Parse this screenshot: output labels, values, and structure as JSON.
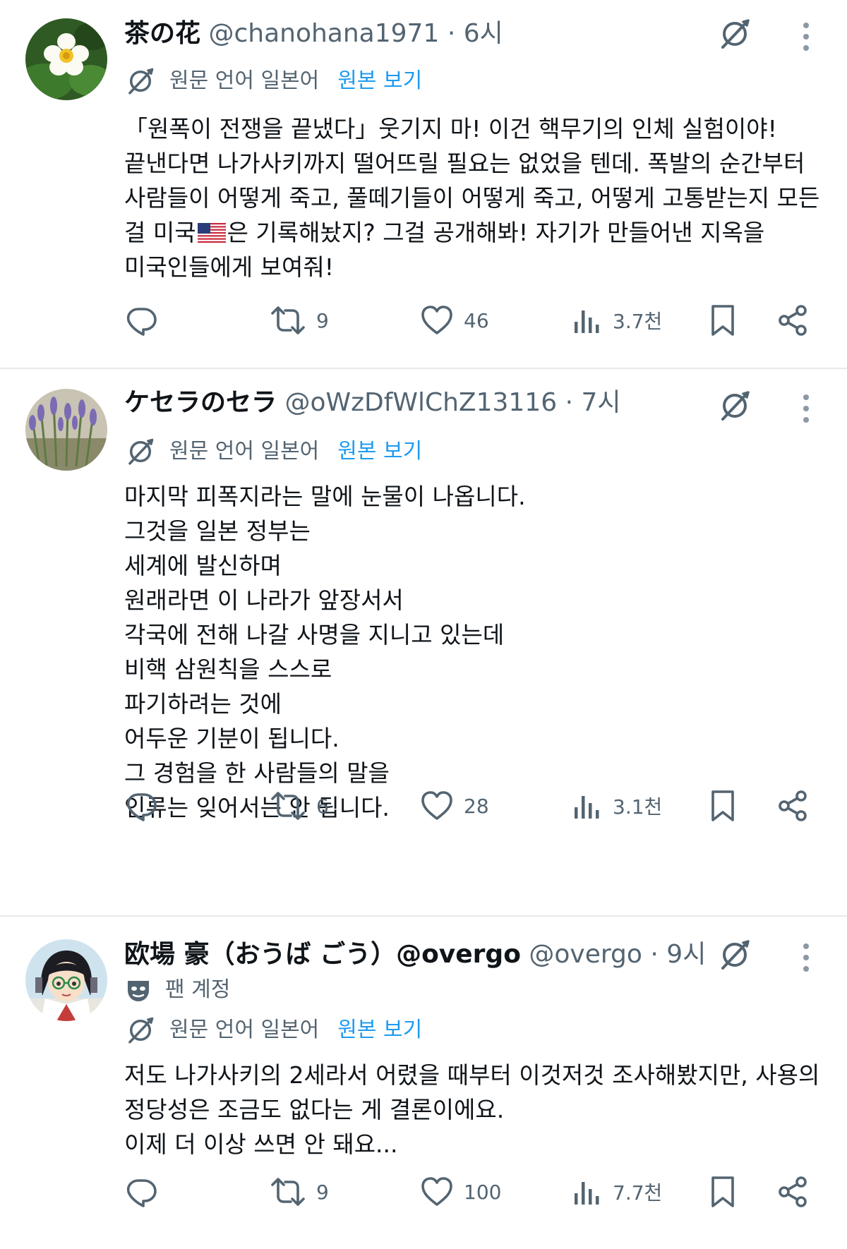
{
  "translate": {
    "lang_label": "원문 언어 일본어",
    "show_original": "원본 보기"
  },
  "tweets": [
    {
      "display_name": "茶の花",
      "handle": "@chanohana1971",
      "time": "6시",
      "text_before_flag": "「원폭이 전쟁을 끝냈다」웃기지 마! 이건 핵무기의 인체 실험이야!\n끝낸다면 나가사키까지 떨어뜨릴 필요는 없었을 텐데. 폭발의 순간부터\n사람들이 어떻게 죽고, 풀떼기들이 어떻게 죽고, 어떻게 고통받는지 모든\n걸 미국",
      "flag": "us-flag",
      "text_after_flag": "은 기록해놨지? 그걸 공개해봐! 자기가 만들어낸 지옥을\n미국인들에게 보여줘!",
      "retweets": "9",
      "likes": "46",
      "views": "3.7천"
    },
    {
      "display_name": "ケセラのセラ",
      "handle": "@oWzDfWlChZ13116",
      "time": "7시",
      "text": "마지막 피폭지라는 말에 눈물이 나옵니다.\n그것을 일본 정부는\n세계에 발신하며\n원래라면 이 나라가 앞장서서\n각국에 전해 나갈 사명을 지니고 있는데\n비핵 삼원칙을 스스로\n파기하려는 것에\n어두운 기분이 됩니다.\n그 경험을 한 사람들의 말을\n인류는 잊어서는 안 됩니다.",
      "retweets": "6",
      "likes": "28",
      "views": "3.1천"
    },
    {
      "display_name": "欧場 豪（おうば ごう）@overgo",
      "handle": "@overgo",
      "time": "9시",
      "fan_label": "팬 계정",
      "text": "저도 나가사키의 2세라서 어렸을 때부터 이것저것 조사해봤지만, 사용의\n정당성은 조금도 없다는 게 결론이에요.\n이제 더 이상 쓰면 안 돼요...",
      "retweets": "9",
      "likes": "100",
      "views": "7.7천"
    }
  ],
  "colors": {
    "link": "#1d9bf0",
    "secondary": "#536471",
    "divider": "#e7e9ea",
    "text": "#0f1419"
  },
  "icons": [
    "translate-icon",
    "more-icon",
    "reply-icon",
    "retweet-icon",
    "like-icon",
    "views-icon",
    "bookmark-icon",
    "share-icon",
    "fan-account-icon"
  ]
}
